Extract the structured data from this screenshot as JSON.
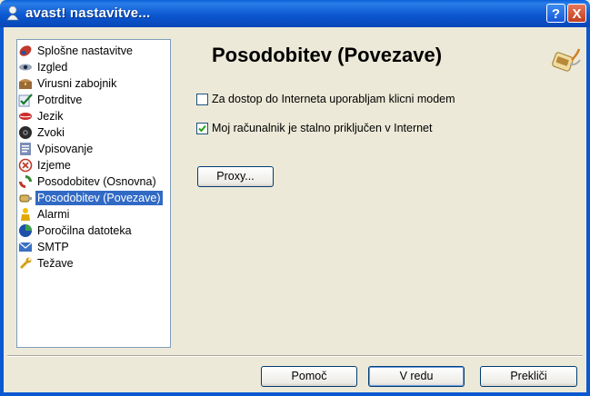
{
  "window": {
    "title": "avast! nastavitve...",
    "help_label": "?",
    "close_label": "X"
  },
  "sidebar": {
    "items": [
      {
        "label": "Splošne nastavitve",
        "icon": "avast-ball-icon"
      },
      {
        "label": "Izgled",
        "icon": "eye-icon"
      },
      {
        "label": "Virusni zabojnik",
        "icon": "chest-icon"
      },
      {
        "label": "Potrditve",
        "icon": "checkmark-icon"
      },
      {
        "label": "Jezik",
        "icon": "lips-icon"
      },
      {
        "label": "Zvoki",
        "icon": "speaker-icon"
      },
      {
        "label": "Vpisovanje",
        "icon": "log-icon"
      },
      {
        "label": "Izjeme",
        "icon": "exclusion-icon"
      },
      {
        "label": "Posodobitev (Osnovna)",
        "icon": "update-icon"
      },
      {
        "label": "Posodobitev (Povezave)",
        "icon": "connection-icon"
      },
      {
        "label": "Alarmi",
        "icon": "alarm-icon"
      },
      {
        "label": "Poročilna datoteka",
        "icon": "report-icon"
      },
      {
        "label": "SMTP",
        "icon": "smtp-icon"
      },
      {
        "label": "Težave",
        "icon": "wrench-icon"
      }
    ],
    "selected_index": 9
  },
  "content": {
    "title": "Posodobitev (Povezave)",
    "options": [
      {
        "label": "Za dostop do Interneta uporabljam klicni modem",
        "checked": false
      },
      {
        "label": "Moj računalnik je stalno priključen v Internet",
        "checked": true
      }
    ],
    "proxy_label": "Proxy..."
  },
  "footer": {
    "help_label": "Pomoč",
    "ok_label": "V redu",
    "cancel_label": "Prekliči"
  }
}
